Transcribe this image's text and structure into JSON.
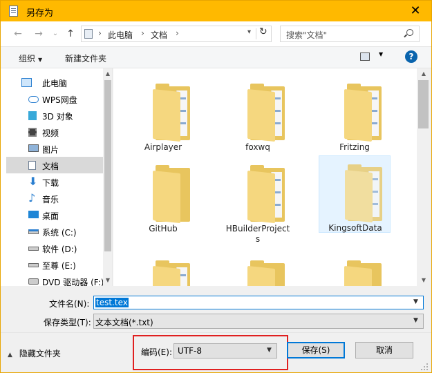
{
  "title_bar": {
    "title": "另存为",
    "close_glyph": "✕"
  },
  "nav": {
    "back_glyph": "←",
    "forward_glyph": "→",
    "recent_glyph": "⌄",
    "up_glyph": "↑",
    "breadcrumb": [
      "此电脑",
      "文档"
    ],
    "search_placeholder": "搜索\"文档\""
  },
  "command_bar": {
    "organize": "组织",
    "new_folder": "新建文件夹",
    "help": "?"
  },
  "sidebar": {
    "items": [
      {
        "label": "此电脑",
        "icon": "computer-icon"
      },
      {
        "label": "WPS网盘",
        "icon": "cloud-icon"
      },
      {
        "label": "3D 对象",
        "icon": "3d-objects-icon"
      },
      {
        "label": "视频",
        "icon": "video-icon"
      },
      {
        "label": "图片",
        "icon": "pictures-icon"
      },
      {
        "label": "文档",
        "icon": "documents-icon",
        "selected": true
      },
      {
        "label": "下载",
        "icon": "download-icon"
      },
      {
        "label": "音乐",
        "icon": "music-icon"
      },
      {
        "label": "桌面",
        "icon": "desktop-icon"
      },
      {
        "label": "系统 (C:)",
        "icon": "drive-c-icon"
      },
      {
        "label": "软件 (D:)",
        "icon": "drive-icon"
      },
      {
        "label": "至尊 (E:)",
        "icon": "drive-icon"
      },
      {
        "label": "DVD 驱动器 (F:)",
        "icon": "dvd-drive-icon"
      }
    ]
  },
  "files": [
    {
      "name": "Airplayer"
    },
    {
      "name": "foxwq"
    },
    {
      "name": "Fritzing"
    },
    {
      "name": "GitHub"
    },
    {
      "name": "HBuilderProjects",
      "line1": "HBuilderProject",
      "line2": "s"
    },
    {
      "name": "KingsoftData",
      "selected": true
    },
    {
      "name": ""
    },
    {
      "name": ""
    },
    {
      "name": ""
    }
  ],
  "form": {
    "filename_label": "文件名(N):",
    "filename_value": "test.tex",
    "filetype_label": "保存类型(T):",
    "filetype_value": "文本文档(*.txt)"
  },
  "footer": {
    "hide_folders": "隐藏文件夹",
    "encoding_label": "编码(E):",
    "encoding_value": "UTF-8",
    "save": "保存(S)",
    "cancel": "取消"
  },
  "colors": {
    "title_bar": "#ffb900",
    "accent": "#0078d7",
    "highlight_box": "#e02020",
    "folder": "#f5d77f"
  }
}
